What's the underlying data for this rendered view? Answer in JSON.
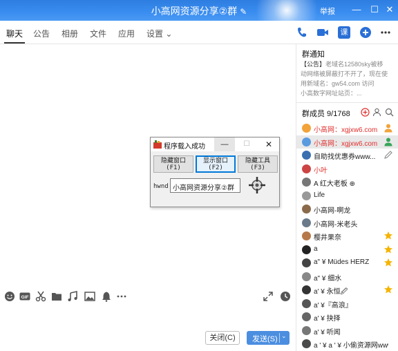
{
  "window": {
    "title": "小高网资源分享②群",
    "report_label": "举报",
    "minimize": "—",
    "maximize": "☐",
    "close": "✕"
  },
  "tabs": [
    {
      "label": "聊天"
    },
    {
      "label": "公告"
    },
    {
      "label": "相册"
    },
    {
      "label": "文件"
    },
    {
      "label": "应用"
    },
    {
      "label": "设置 ⌄"
    }
  ],
  "toolbar_icons": [
    "phone-icon",
    "video-icon",
    "classroom-icon",
    "add-icon",
    "more-icon"
  ],
  "class_icon_label": "课",
  "input_toolbar_icons": [
    "emoji-icon",
    "gif-icon",
    "scissors-icon",
    "folder-icon",
    "music-icon",
    "image-icon",
    "bell-icon",
    "ellipsis-icon",
    "expand-icon",
    "history-icon"
  ],
  "buttons": {
    "close": "关闭(C)",
    "send": "发送(S)",
    "send_dropdown": "⌄"
  },
  "notice": {
    "title": "群通知",
    "prefix": "【公告】",
    "text": "老域名12580sky被移动网络被屏蔽打不开了，现在使用新域名：gw54.com 访问",
    "text2": "小高数字网址站页：..."
  },
  "members": {
    "title": "群成员 9/1768",
    "list": [
      {
        "name": "小高网：xgjxw6.com",
        "color": "red",
        "badge": "owner",
        "selected": false
      },
      {
        "name": "小高网：xgjxw6.com",
        "color": "red",
        "badge": "admin",
        "selected": true
      },
      {
        "name": "自助找优惠券www...",
        "color": "normal",
        "badge": "edit",
        "selected": false
      },
      {
        "name": "小叶",
        "color": "red",
        "badge": "",
        "selected": false
      },
      {
        "name": "A 红大老板 ⊕",
        "color": "normal",
        "badge": "",
        "selected": false
      },
      {
        "name": "Life",
        "color": "normal",
        "badge": "",
        "selected": false
      },
      {
        "name": "小高网-啊龙",
        "color": "normal",
        "badge": "",
        "selected": false
      },
      {
        "name": "小高网-米老头",
        "color": "normal",
        "badge": "",
        "selected": false
      },
      {
        "name": "樱井果奈",
        "color": "normal",
        "badge": "star",
        "selected": false
      },
      {
        "name": "a",
        "color": "normal",
        "badge": "star",
        "selected": false
      },
      {
        "name": "a\" ¥ Müdes HERZ",
        "color": "normal",
        "badge": "star",
        "selected": false
      },
      {
        "name": "a\" ¥ 细水",
        "color": "normal",
        "badge": "",
        "selected": false
      },
      {
        "name": "a' ¥ 永恒🖉",
        "color": "normal",
        "badge": "star",
        "selected": false
      },
      {
        "name": "a' ¥『高浪』",
        "color": "normal",
        "badge": "",
        "selected": false
      },
      {
        "name": "a' ¥ 抉择",
        "color": "normal",
        "badge": "",
        "selected": false
      },
      {
        "name": "a' ¥ 听闻",
        "color": "normal",
        "badge": "",
        "selected": false
      },
      {
        "name": "a ' ¥ a ' ¥ 小偷资源网www...",
        "color": "normal",
        "badge": "",
        "selected": false
      }
    ]
  },
  "popup": {
    "title": "程序载入成功",
    "min": "—",
    "max": "☐",
    "close": "✕",
    "btn1_line1": "隐藏窗口",
    "btn1_line2": "(F1)",
    "btn2_line1": "显示窗口",
    "btn2_line2": "(F2)",
    "btn3_line1": "隐藏工具",
    "btn3_line2": "(F3)",
    "hwnd_label": "hwnd",
    "hwnd_value": "小高网资源分享②群"
  },
  "colors": {
    "titlebar": "#3a8df0",
    "accent": "#2e7de0",
    "red_name": "#e0302e",
    "star": "#f5b400"
  }
}
